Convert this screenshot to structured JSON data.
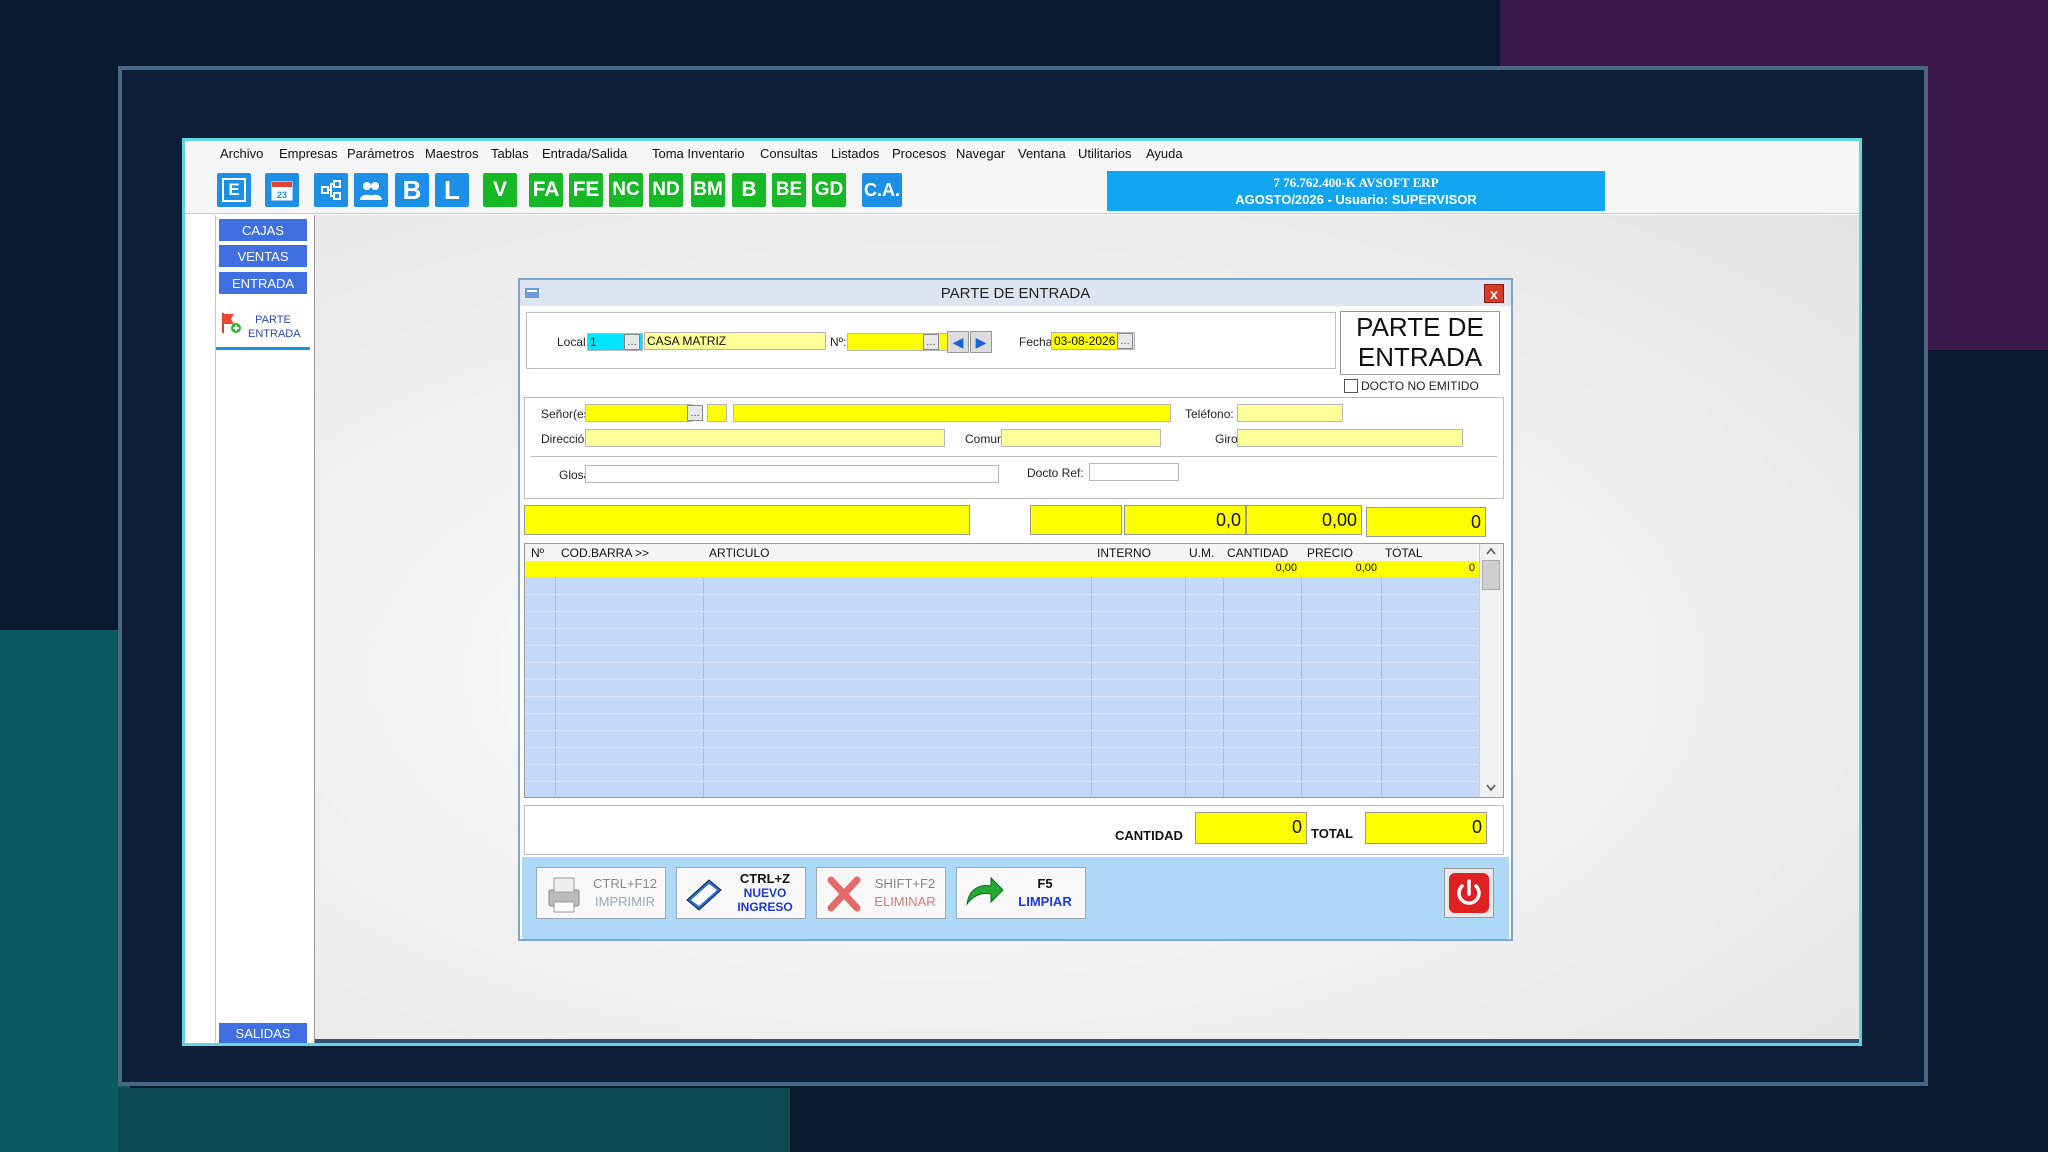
{
  "menu": [
    "Archivo",
    "Empresas",
    "Parámetros",
    "Maestros",
    "Tablas",
    "Entrada/Salida",
    "Toma Inventario",
    "Consultas",
    "Listados",
    "Procesos",
    "Navegar",
    "Ventana",
    "Utilitarios",
    "Ayuda"
  ],
  "toolbar": {
    "blue_letters": [
      "E",
      "B",
      "L"
    ],
    "green_labels": [
      "V",
      "FA",
      "FE",
      "NC",
      "ND",
      "BM",
      "B",
      "BE",
      "GD"
    ],
    "ca_label": "C.A."
  },
  "company": {
    "line1": "7  76.762.400-K  AVSOFT ERP",
    "line2": "AGOSTO/2026  -  Usuario: SUPERVISOR"
  },
  "sidebar": {
    "items": [
      "CAJAS",
      "VENTAS",
      "ENTRADA"
    ],
    "sub_item": "PARTE ENTRADA",
    "bottom": "SALIDAS"
  },
  "dialog": {
    "title": "PARTE DE ENTRADA",
    "close": "x",
    "doc_title_l1": "PARTE DE",
    "doc_title_l2": "ENTRADA",
    "docto_no_emitido": "DOCTO NO EMITIDO",
    "header": {
      "local_label": "Local:",
      "local_value": "1",
      "local_name": "CASA MATRIZ",
      "numero_label": "Nº:",
      "numero_value": "",
      "fecha_label": "Fecha:",
      "fecha_value": "03-08-2026"
    },
    "client": {
      "senores_label": "Señor(es):",
      "telefono_label": "Teléfono:",
      "direccion_label": "Dirección:",
      "comuna_label": "Comuna:",
      "giro_label": "Giro:",
      "glosa_label": "Glosa:",
      "docto_ref_label": "Docto Ref:"
    },
    "entry_row": {
      "qty": "0,0",
      "price": "0,00",
      "total": "0"
    },
    "grid": {
      "columns": [
        "Nº",
        "COD.BARRA >>",
        "ARTICULO",
        "INTERNO",
        "U.M.",
        "CANTIDAD",
        "PRECIO",
        "TOTAL"
      ],
      "row0": {
        "cantidad": "0,00",
        "precio": "0,00",
        "total": "0"
      }
    },
    "totals": {
      "cantidad_label": "CANTIDAD",
      "cantidad_value": "0",
      "total_label": "TOTAL",
      "total_value": "0"
    },
    "actions": [
      {
        "key": "CTRL+F12",
        "label": "IMPRIMIR"
      },
      {
        "key": "CTRL+Z",
        "label": "NUEVO INGRESO"
      },
      {
        "key": "SHIFT+F2",
        "label": "ELIMINAR"
      },
      {
        "key": "F5",
        "label": "LIMPIAR"
      }
    ]
  },
  "colors": {
    "toolbar_blue": "#1c8fe6",
    "toolbar_green": "#16b826",
    "field_yellow": "#ffff00",
    "field_cyan": "#00e5ff",
    "grid_blue": "#c4d8f8",
    "action_bar": "#add8f8"
  },
  "icons": [
    "calendar-icon",
    "tree-icon",
    "users-icon",
    "printer-icon",
    "notebook-icon",
    "delete-x-icon",
    "refresh-arrow-icon",
    "power-icon",
    "parte-entrada-icon",
    "nav-left-icon",
    "nav-right-icon"
  ]
}
